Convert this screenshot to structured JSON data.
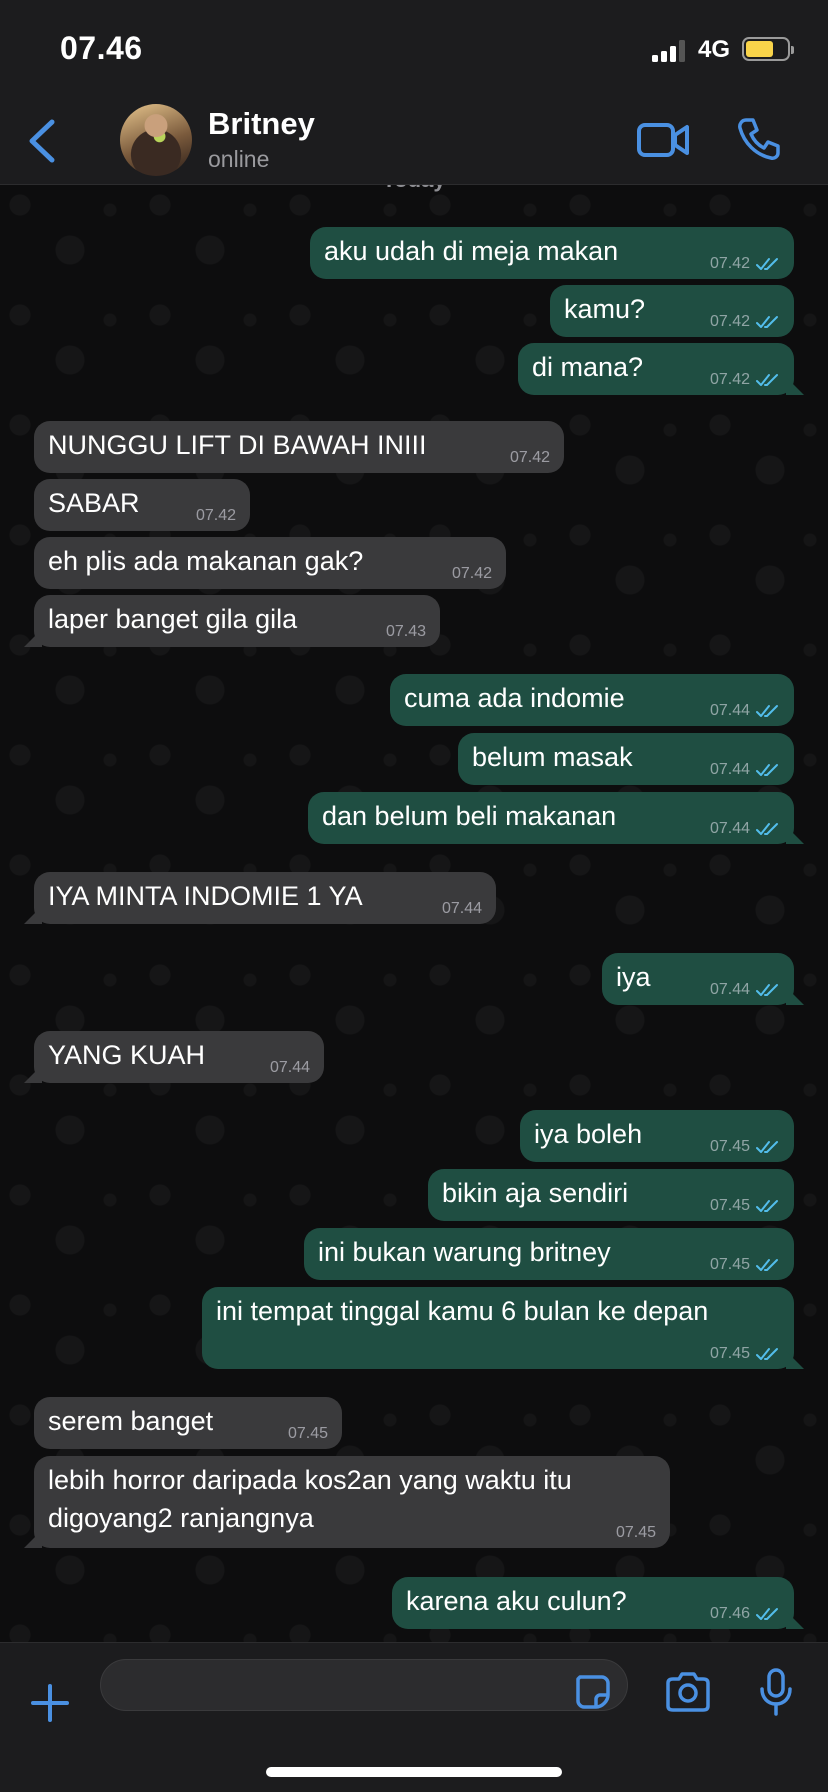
{
  "status_bar": {
    "time": "07.46",
    "network": "4G",
    "battery_level": 0.68,
    "signal_bars": 3
  },
  "header": {
    "back_icon": "chevron-left-icon",
    "contact_name": "Britney",
    "contact_status": "online",
    "video_icon": "video-camera-icon",
    "call_icon": "phone-icon"
  },
  "chat": {
    "date_label": "Today",
    "messages": [
      {
        "dir": "out",
        "text": "aku udah di meja makan",
        "time": "07.42",
        "read": true
      },
      {
        "dir": "out",
        "text": "kamu?",
        "time": "07.42",
        "read": true
      },
      {
        "dir": "out",
        "text": "di mana?",
        "time": "07.42",
        "read": true
      },
      {
        "dir": "in",
        "text": "NUNGGU LIFT DI BAWAH INIII",
        "time": "07.42"
      },
      {
        "dir": "in",
        "text": "SABAR",
        "time": "07.42"
      },
      {
        "dir": "in",
        "text": "eh plis ada makanan gak?",
        "time": "07.42"
      },
      {
        "dir": "in",
        "text": "laper banget gila gila",
        "time": "07.43"
      },
      {
        "dir": "out",
        "text": "cuma ada indomie",
        "time": "07.44",
        "read": true
      },
      {
        "dir": "out",
        "text": "belum masak",
        "time": "07.44",
        "read": true
      },
      {
        "dir": "out",
        "text": "dan belum beli makanan",
        "time": "07.44",
        "read": true
      },
      {
        "dir": "in",
        "text": "IYA MINTA INDOMIE 1 YA",
        "time": "07.44"
      },
      {
        "dir": "out",
        "text": "iya",
        "time": "07.44",
        "read": true
      },
      {
        "dir": "in",
        "text": "YANG KUAH",
        "time": "07.44"
      },
      {
        "dir": "out",
        "text": "iya boleh",
        "time": "07.45",
        "read": true
      },
      {
        "dir": "out",
        "text": "bikin aja sendiri",
        "time": "07.45",
        "read": true
      },
      {
        "dir": "out",
        "text": "ini bukan warung britney",
        "time": "07.45",
        "read": true
      },
      {
        "dir": "out",
        "text": "ini tempat tinggal kamu 6 bulan ke depan",
        "time": "07.45",
        "read": true
      },
      {
        "dir": "in",
        "text": "serem banget",
        "time": "07.45"
      },
      {
        "dir": "in",
        "text": "lebih horror daripada kos2an yang waktu itu digoyang2 ranjangnya",
        "time": "07.45"
      },
      {
        "dir": "out",
        "text": "karena aku culun?",
        "time": "07.46",
        "read": true
      }
    ]
  },
  "input_bar": {
    "placeholder": "",
    "icons": [
      "plus-icon",
      "sticker-icon",
      "camera-icon",
      "microphone-icon"
    ]
  },
  "colors": {
    "accent": "#4a90e2",
    "outgoing_bubble": "#1f4e42",
    "incoming_bubble": "#3a3a3c",
    "read_ticks": "#53bdeb"
  }
}
